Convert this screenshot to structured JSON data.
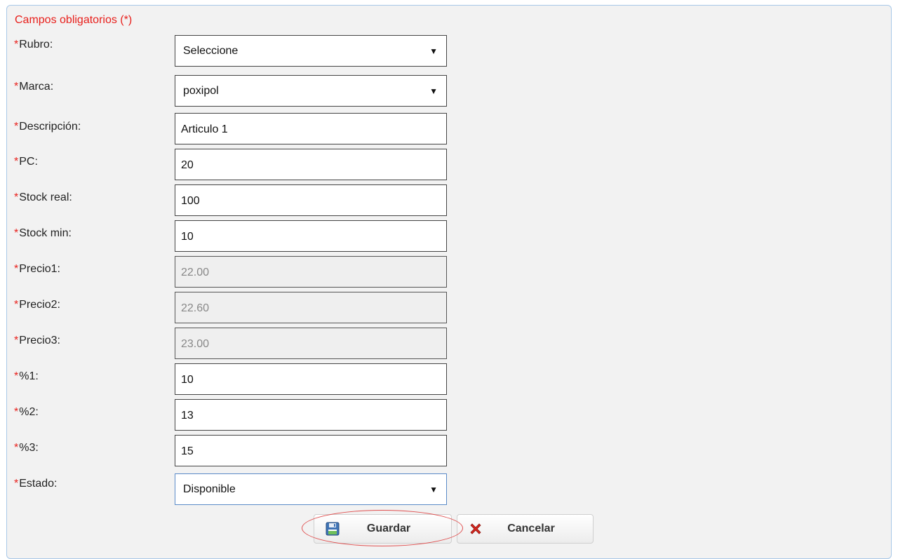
{
  "form": {
    "required_note": "Campos obligatorios (*)",
    "required_marker": "*",
    "fields": [
      {
        "label": "Rubro:",
        "value": "Seleccione"
      },
      {
        "label": "Marca:",
        "value": "poxipol"
      },
      {
        "label": "Descripción:",
        "value": "Articulo 1"
      },
      {
        "label": "PC:",
        "value": "20"
      },
      {
        "label": "Stock real:",
        "value": "100"
      },
      {
        "label": "Stock min:",
        "value": "10"
      },
      {
        "label": "Precio1:",
        "value": "22.00"
      },
      {
        "label": "Precio2:",
        "value": "22.60"
      },
      {
        "label": "Precio3:",
        "value": "23.00"
      },
      {
        "label": "%1:",
        "value": "10"
      },
      {
        "label": "%2:",
        "value": "13"
      },
      {
        "label": "%3:",
        "value": "15"
      },
      {
        "label": "Estado:",
        "value": "Disponible"
      }
    ],
    "select_arrow": "▼"
  },
  "actions": {
    "save_label": "Guardar",
    "cancel_label": "Cancelar",
    "save_icon": "floppy-disk-icon",
    "cancel_icon": "red-x-icon"
  },
  "colors": {
    "required": "#e8201c",
    "panel_border": "#a8c8e8",
    "highlight": "#e05050"
  }
}
